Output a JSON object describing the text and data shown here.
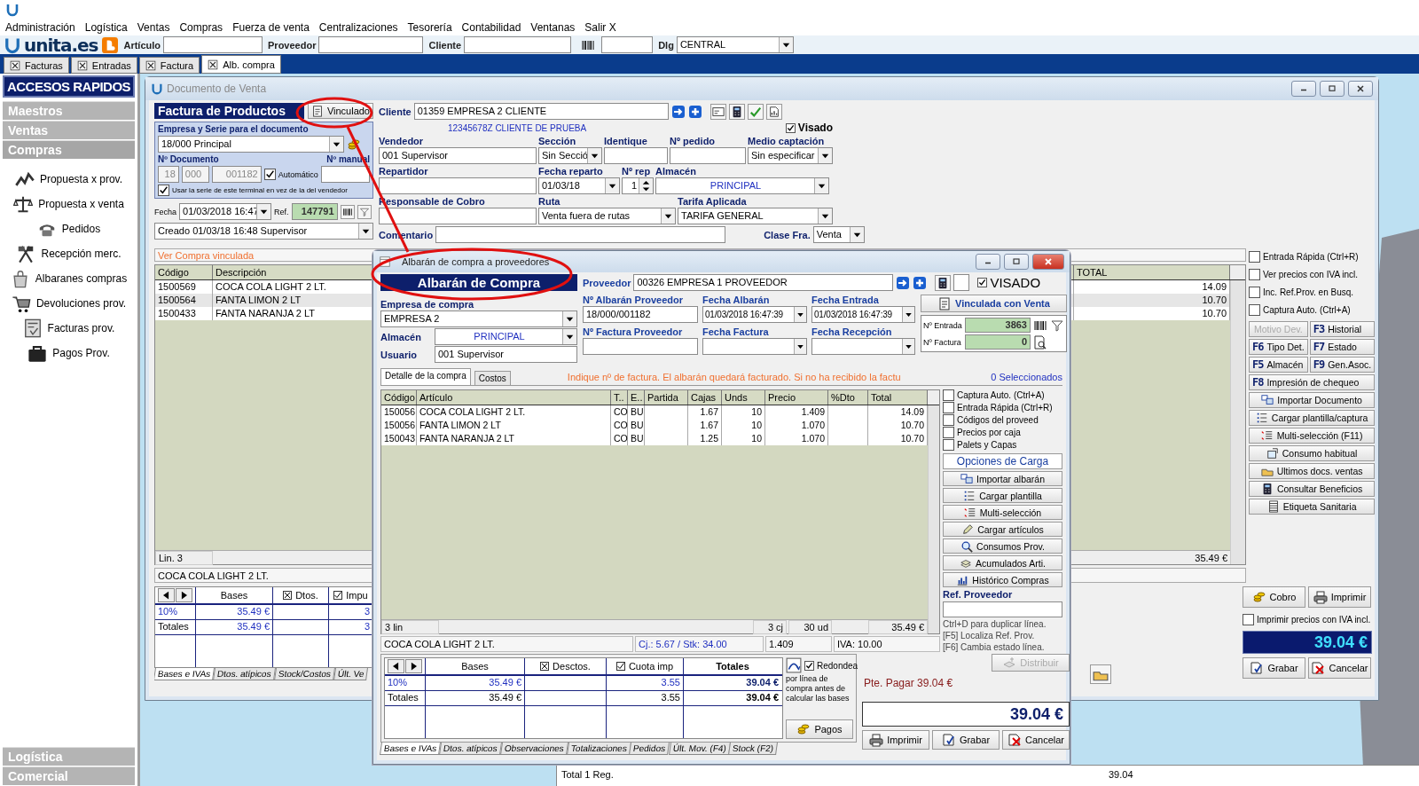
{
  "menu": [
    "Administración",
    "Logística",
    "Ventas",
    "Compras",
    "Fuerza de venta",
    "Centralizaciones",
    "Tesorería",
    "Contabilidad",
    "Ventanas",
    "Salir X"
  ],
  "toolbar": {
    "logo_text": "unita.es",
    "fields": [
      {
        "label": "Artículo"
      },
      {
        "label": "Proveedor"
      },
      {
        "label": "Cliente"
      }
    ],
    "dlg_label": "Dlg",
    "dlg_value": "CENTRAL"
  },
  "doc_tabs": [
    {
      "label": "Facturas",
      "selected": false
    },
    {
      "label": "Entradas",
      "selected": false
    },
    {
      "label": "Factura",
      "selected": false
    },
    {
      "label": "Alb. compra",
      "selected": true
    }
  ],
  "sidebar": {
    "title": "ACCESOS RAPIDOS",
    "groups": [
      {
        "label": "Maestros",
        "expanded": false
      },
      {
        "label": "Ventas",
        "expanded": false
      },
      {
        "label": "Compras",
        "expanded": true,
        "items": [
          "Propuesta x prov.",
          "Propuesta x venta",
          "Pedidos",
          "Recepción merc.",
          "Albaranes compras",
          "Devoluciones prov.",
          "Facturas prov.",
          "Pagos Prov."
        ]
      },
      {
        "label": "Logística",
        "expanded": false
      },
      {
        "label": "Comercial",
        "expanded": false
      }
    ]
  },
  "sales_window": {
    "title": "Documento de Venta",
    "doc_title": "Factura de Productos",
    "linked_button": "Vinculado",
    "series_label": "Empresa y Serie para el documento",
    "series_value": "18/000 Principal",
    "docnum_label": "Nº Documento",
    "manual_label": "Nº manual",
    "docnum_parts": [
      "18",
      "000",
      "001182"
    ],
    "auto": {
      "label": "Automático",
      "checked": true
    },
    "use_terminal_series": {
      "label": "Usar la serie de este terminal en vez de la del vendedor",
      "checked": true
    },
    "date_label": "Fecha",
    "date_value": "01/03/2018 16:47",
    "ref_label": "Ref.",
    "ref_value": "147791",
    "created": "Creado 01/03/18 16:48 Supervisor",
    "client_label": "Cliente",
    "client_value": "01359 EMPRESA 2 CLIENTE",
    "client_tax_id": "12345678Z CLIENTE DE PRUEBA",
    "visado": {
      "label": "Visado",
      "checked": true
    },
    "field_rows": [
      [
        {
          "label": "Vendedor",
          "value": "001 Supervisor",
          "kind": "text"
        },
        {
          "label": "Sección",
          "value": "Sin Secció",
          "kind": "combo"
        },
        {
          "label": "Identique",
          "kind": "text"
        },
        {
          "label": "Nº pedido",
          "kind": "text"
        },
        {
          "label": "Medio captación",
          "value": "Sin especificar",
          "kind": "combo"
        }
      ],
      [
        {
          "label": "Repartidor",
          "kind": "text"
        },
        {
          "label": "Fecha reparto",
          "value": "01/03/18",
          "kind": "combo"
        },
        {
          "label": "Nº rep",
          "value": "1",
          "kind": "spin"
        },
        {
          "label": "Almacén",
          "value": "PRINCIPAL",
          "kind": "combo"
        }
      ],
      [
        {
          "label": "Responsable de Cobro",
          "kind": "text"
        },
        {
          "label": "Ruta",
          "value": "Venta fuera de rutas",
          "kind": "combo"
        },
        {
          "label": "Tarifa Aplicada",
          "value": "TARIFA GENERAL",
          "kind": "combo"
        }
      ]
    ],
    "comment_label": "Comentario",
    "invoice_class_label": "Clase Fra.",
    "invoice_class_value": "Venta",
    "linked_purchase": "Ver Compra vinculada",
    "grid": {
      "columns": [
        "Código",
        "Descripción",
        "TOTAL"
      ],
      "rows": [
        {
          "code": "1500569",
          "description": "COCA COLA LIGHT 2 LT.",
          "total": "14.09"
        },
        {
          "code": "1500564",
          "description": "FANTA LIMON 2 LT",
          "total": "10.70"
        },
        {
          "code": "1500433",
          "description": "FANTA NARANJA 2 LT",
          "total": "10.70"
        }
      ]
    },
    "line_count": "Lin. 3",
    "grid_total": "35.49 €",
    "current_item": "COCA COLA LIGHT 2 LT.",
    "options": [
      {
        "label": "Entrada Rápida (Ctrl+R)",
        "checked": false
      },
      {
        "label": "Ver precios con IVA incl.",
        "checked": false
      },
      {
        "label": "Inc. Ref.Prov. en Busq.",
        "checked": false
      },
      {
        "label": "Captura Auto. (Ctrl+A)",
        "checked": false
      }
    ],
    "function_buttons": [
      {
        "label": "Motivo Dev.",
        "disabled": true
      },
      {
        "key": "F3",
        "label": "Historial",
        "disabled": false
      },
      {
        "key": "F6",
        "label": "Tipo Det.",
        "disabled": false
      },
      {
        "key": "F7",
        "label": "Estado",
        "disabled": false
      },
      {
        "key": "F5",
        "label": "Almacén",
        "disabled": false
      },
      {
        "key": "F9",
        "label": "Gen.Asoc.",
        "disabled": false
      },
      {
        "key": "F8",
        "label": "Impresión de chequeo",
        "disabled": false
      }
    ],
    "action_buttons": [
      "Importar Documento",
      "Cargar plantilla/captura",
      "Multi-selección (F11)",
      "Consumo habitual",
      "Ultimos docs. ventas",
      "Consultar Beneficios",
      "Etiqueta Sanitaria"
    ],
    "taxes": {
      "columns": [
        {
          "label": "Bases"
        },
        {
          "label": "Dtos.",
          "checked": false
        },
        {
          "label": "Impu",
          "checked": true
        }
      ],
      "rows": [
        {
          "label": "10%",
          "base": "35.49 €",
          "tax": "3"
        },
        {
          "label": "Totales",
          "base": "35.49 €",
          "tax": "3"
        }
      ]
    },
    "tabs": [
      {
        "label": "Bases e IVAs",
        "selected": true
      },
      {
        "label": "Dtos. atípicos",
        "selected": false
      },
      {
        "label": "Stock/Costos",
        "selected": false
      },
      {
        "label": "Últ. Ve",
        "selected": false
      }
    ],
    "collect_button": "Cobro",
    "print_button": "Imprimir",
    "print_vat": {
      "label": "Imprimir precios con IVA incl.",
      "checked": false
    },
    "total": "39.04 €",
    "save_button": "Grabar",
    "cancel_button": "Cancelar"
  },
  "purchase_dialog": {
    "title": "Albarán de compra a proveedores",
    "heading": "Albarán de Compra",
    "company_label": "Empresa de compra",
    "company_value": "EMPRESA 2",
    "warehouse_label": "Almacén",
    "warehouse_value": "PRINCIPAL",
    "user_label": "Usuario",
    "user_value": "001 Supervisor",
    "supplier_label": "Proveedor",
    "supplier_value": "00326 EMPRESA 1 PROVEEDOR",
    "visado": {
      "label": "VISADO",
      "checked": true
    },
    "fields": [
      {
        "label": "Nº Albarán Proveedor",
        "value": "18/000/001182",
        "kind": "text"
      },
      {
        "label": "Fecha Albarán",
        "value": "01/03/2018 16:47:39",
        "kind": "combo"
      },
      {
        "label": "Fecha Entrada",
        "value": "01/03/2018 16:47:39",
        "kind": "combo"
      },
      {
        "label": "Nº Factura Proveedor",
        "kind": "text"
      },
      {
        "label": "Fecha Factura",
        "kind": "combo"
      },
      {
        "label": "Fecha Recepción",
        "kind": "combo"
      }
    ],
    "linked_button": "Vinculada con Venta",
    "entry_label": "Nº Entrada",
    "entry_value": "3863",
    "invoice_label": "Nº Factura",
    "invoice_value": "0",
    "tabs": [
      {
        "label": "Detalle de la compra",
        "selected": true
      },
      {
        "label": "Costos",
        "selected": false
      }
    ],
    "warning": "Indique nº de factura. El albarán quedará facturado.  Si no ha recibido la factu",
    "selected_count": "0 Seleccionados",
    "grid": {
      "columns": [
        "Código",
        "Artículo",
        "T..",
        "E..",
        "Partida",
        "Cajas",
        "Unds",
        "Precio",
        "%Dto",
        "Total"
      ],
      "rows": [
        {
          "code": "150056",
          "article": "COCA COLA LIGHT 2 LT.",
          "t": "CO",
          "e": "BU",
          "boxes": "1.67",
          "units": "10",
          "price": "1.409",
          "total": "14.09"
        },
        {
          "code": "150056",
          "article": "FANTA LIMON 2 LT",
          "t": "CO",
          "e": "BU",
          "boxes": "1.67",
          "units": "10",
          "price": "1.070",
          "total": "10.70"
        },
        {
          "code": "150043",
          "article": "FANTA NARANJA 2 LT",
          "t": "CO",
          "e": "BU",
          "boxes": "1.25",
          "units": "10",
          "price": "1.070",
          "total": "10.70"
        }
      ]
    },
    "line_count": "3 lin",
    "boxes_total": "3 cj",
    "units_total": "30 ud",
    "grid_total": "35.49 €",
    "current_item": "COCA COLA LIGHT 2 LT.",
    "stock_info": "Cj.: 5.67 / Stk: 34.00",
    "current_price": "1.409",
    "current_vat": "IVA: 10.00",
    "options": [
      {
        "label": "Captura Auto. (Ctrl+A)",
        "checked": false
      },
      {
        "label": "Entrada Rápida (Ctrl+R)",
        "checked": false
      },
      {
        "label": "Códigos del proveed",
        "checked": false
      },
      {
        "label": "Precios por caja",
        "checked": false
      },
      {
        "label": "Palets y Capas",
        "checked": false
      }
    ],
    "load_heading": "Opciones de Carga",
    "load_buttons": [
      "Importar albarán",
      "Cargar plantilla",
      "Multi-selección",
      "Cargar artículos",
      "Consumos Prov.",
      "Acumulados Arti.",
      "Histórico Compras"
    ],
    "supplier_ref_label": "Ref. Proveedor",
    "hints": [
      "Ctrl+D para duplicar línea.",
      "[F5] Localiza Ref. Prov.",
      "[F6] Cambia estado línea."
    ],
    "taxes": {
      "columns": [
        {
          "label": "Bases"
        },
        {
          "label": "Desctos.",
          "checked": false
        },
        {
          "label": "Cuota imp",
          "checked": true
        },
        {
          "label": "Totales"
        }
      ],
      "rows": [
        {
          "label": "10%",
          "base": "35.49 €",
          "tax": "3.55",
          "total": "39.04 €"
        },
        {
          "label": "Totales",
          "base": "35.49 €",
          "tax": "3.55",
          "total": "39.04 €"
        }
      ]
    },
    "rounding": {
      "label": "Redondea",
      "checked": true,
      "note": "por línea de compra antes de calcular las bases"
    },
    "payments_button": "Pagos",
    "distribute_button": {
      "label": "Distribuir",
      "disabled": true
    },
    "pending": "Pte. Pagar 39.04 €",
    "total": "39.04 €",
    "print_button": "Imprimir",
    "save_button": "Grabar",
    "cancel_button": "Cancelar",
    "bottom_tabs": [
      {
        "label": "Bases e IVAs",
        "selected": true
      },
      {
        "label": "Dtos. atípicos",
        "selected": false
      },
      {
        "label": "Observaciones",
        "selected": false
      },
      {
        "label": "Totalizaciones",
        "selected": false
      },
      {
        "label": "Pedidos",
        "selected": false
      },
      {
        "label": "Últ. Mov. (F4)",
        "selected": false
      },
      {
        "label": "Stock (F2)",
        "selected": false
      }
    ]
  },
  "background_window": {
    "summary": "Total 1 Reg.",
    "total": "39.04"
  }
}
